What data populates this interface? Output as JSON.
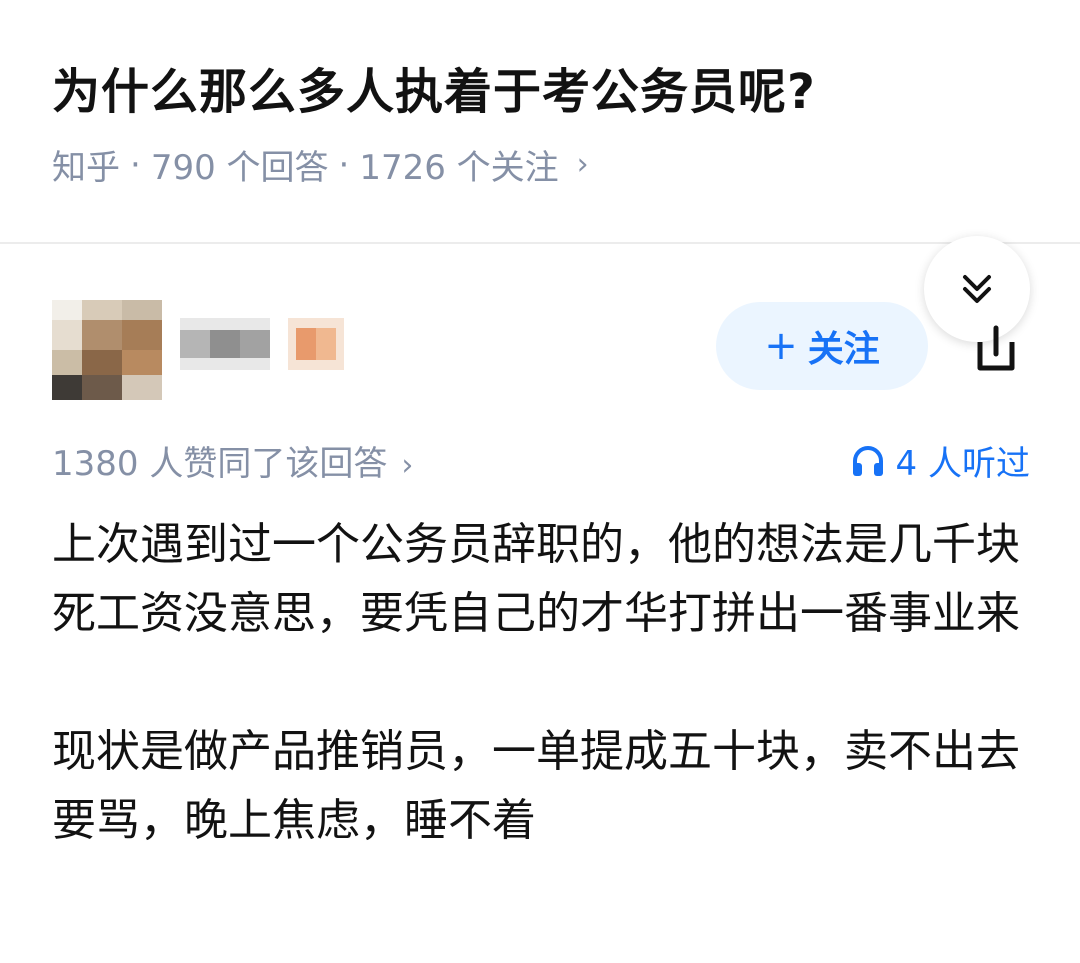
{
  "question": {
    "title": "为什么那么多人执着于考公务员呢?",
    "source": "知乎",
    "answers": "790 个回答",
    "followers": "1726 个关注",
    "separator": "·",
    "chevron": "›"
  },
  "author": {
    "follow_label": "关注",
    "follow_plus": "+"
  },
  "answer_meta": {
    "votes": "1380 人赞同了该回答",
    "chevron": "›",
    "listened": "4 人听过"
  },
  "answer": {
    "paragraphs": [
      "上次遇到过一个公务员辞职的，他的想法是几千块死工资没意思，要凭自己的才华打拼出一番事业来",
      "现状是做产品推销员，一单提成五十块，卖不出去要骂，晚上焦虑，睡不着"
    ]
  },
  "colors": {
    "accent": "#1772f6",
    "meta_gray": "#8590a6",
    "follow_bg": "#ebf5ff"
  },
  "icons": [
    "chevron-double-down-icon",
    "share-icon",
    "headphones-icon"
  ]
}
